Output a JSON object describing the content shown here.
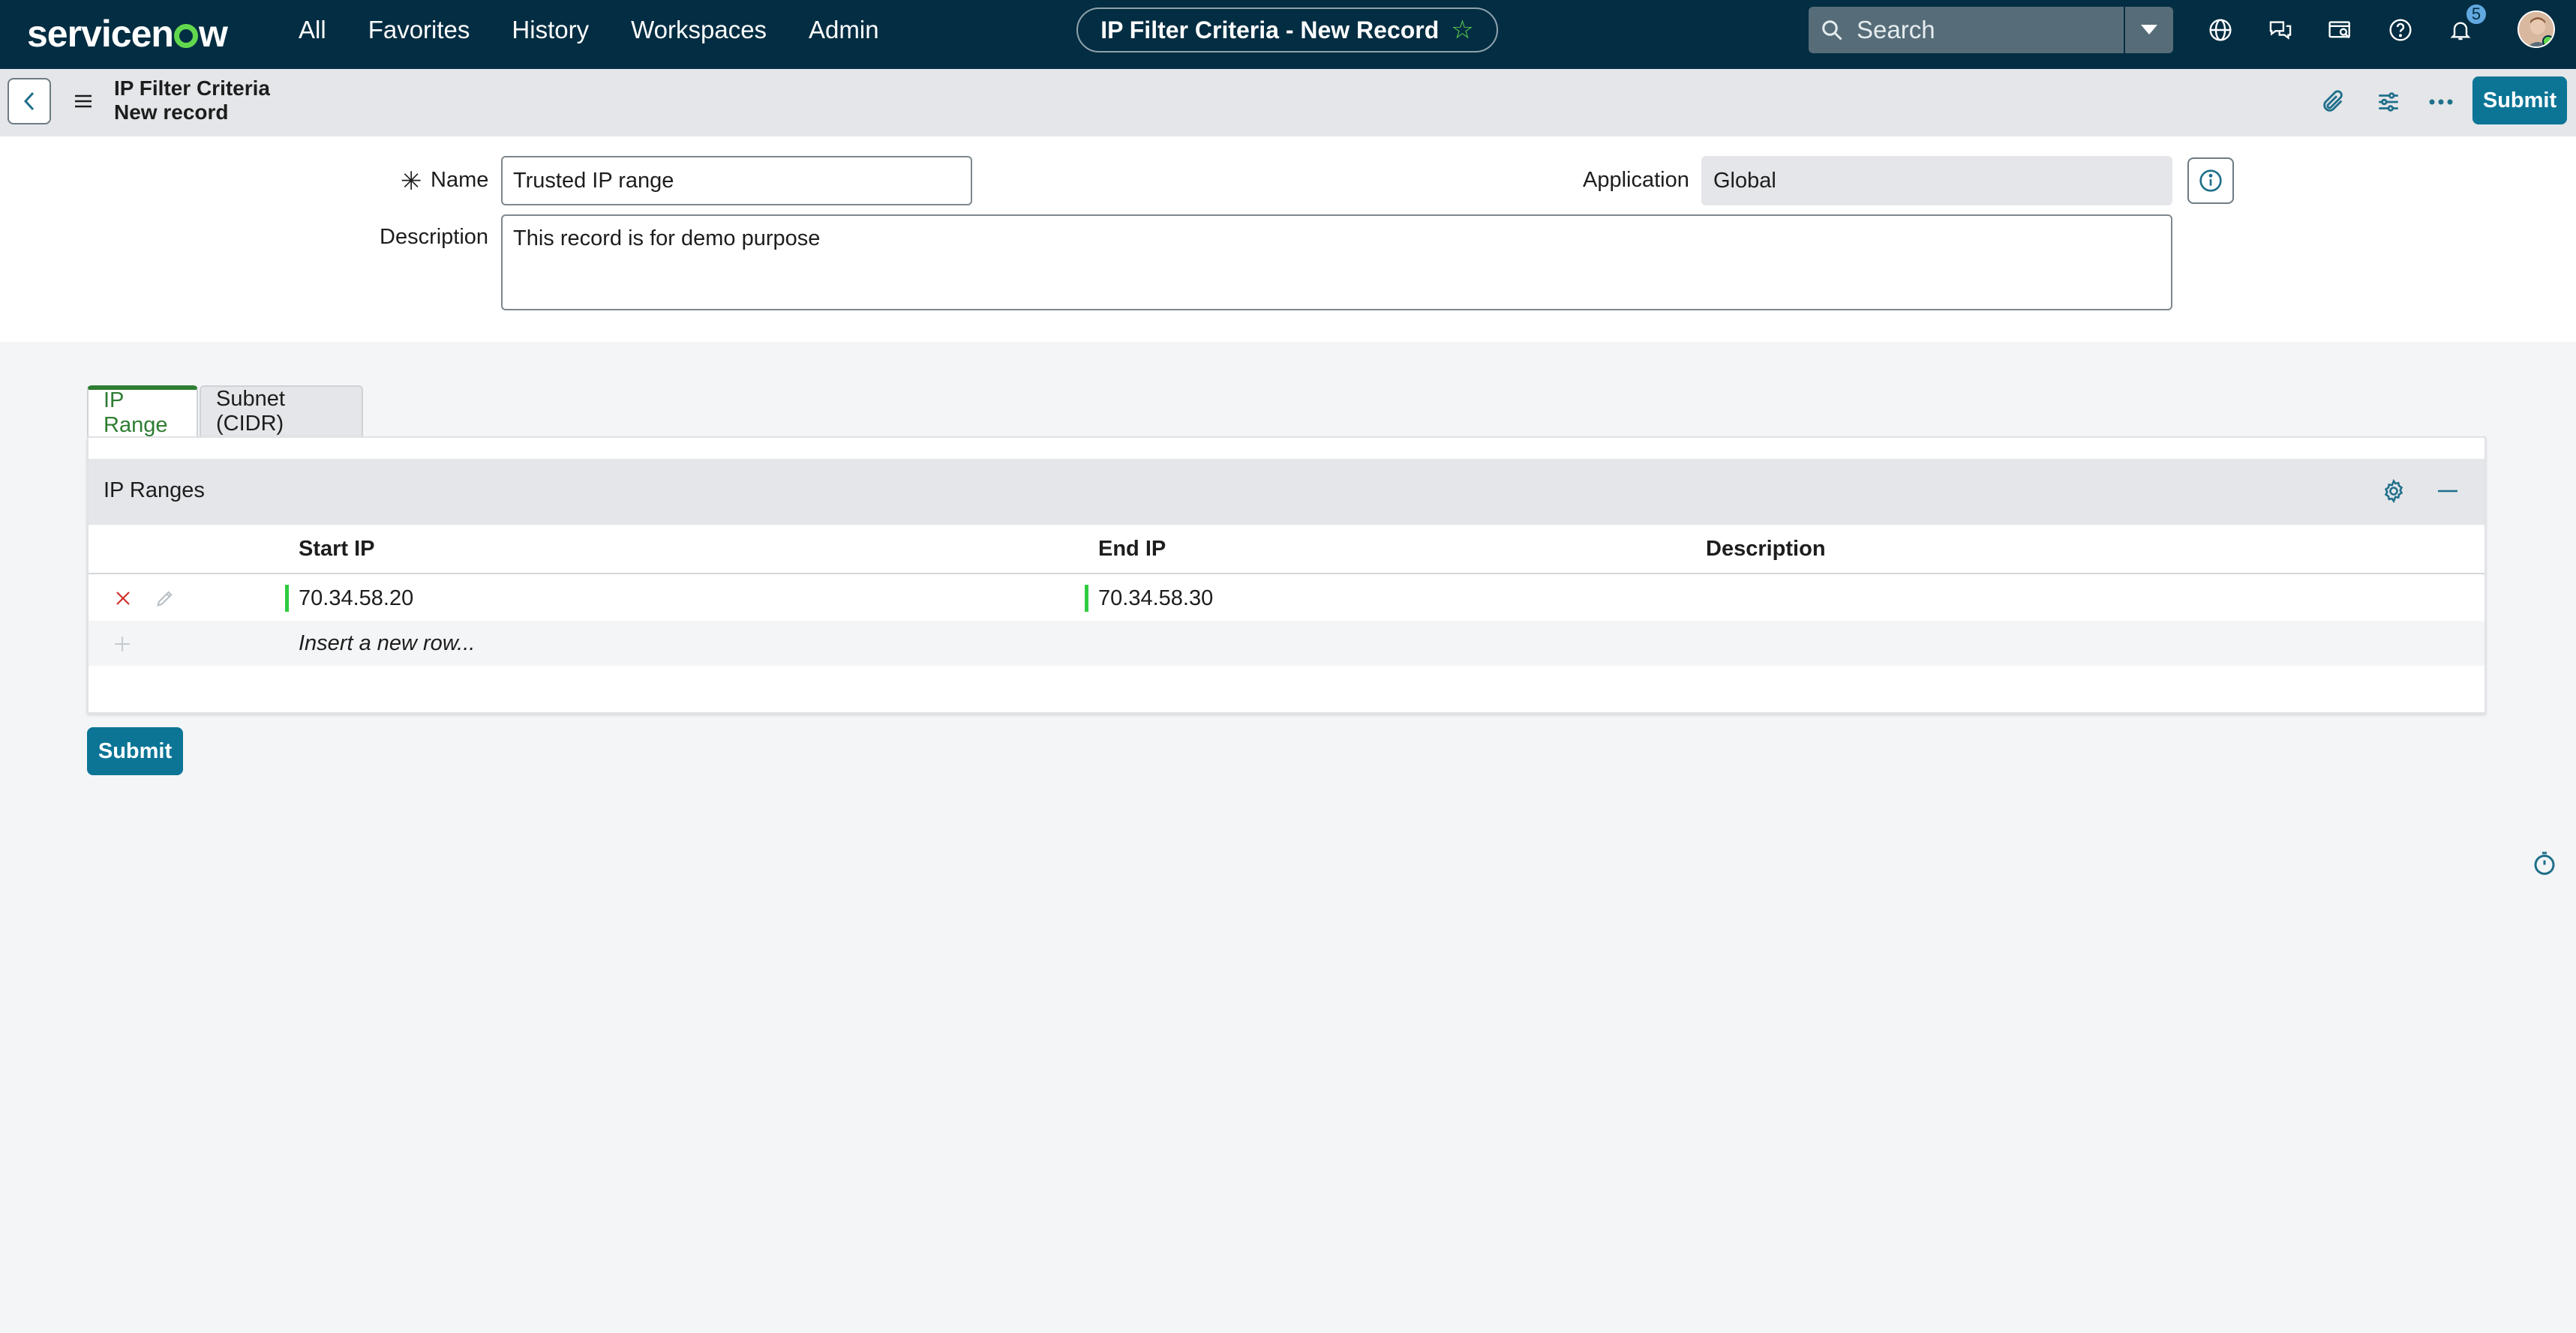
{
  "nav": {
    "logo_pre": "servicen",
    "logo_post": "w",
    "menu": [
      "All",
      "Favorites",
      "History",
      "Workspaces",
      "Admin"
    ],
    "title_pill": "IP Filter Criteria - New Record",
    "search_placeholder": "Search",
    "notification_count": "5",
    "icons": [
      "globe-icon",
      "chat-icon",
      "card-search-icon",
      "help-icon",
      "bell-icon"
    ]
  },
  "record": {
    "title_line1": "IP Filter Criteria",
    "title_line2": "New record",
    "submit_label": "Submit"
  },
  "form": {
    "name_label": "Name",
    "name_value": "Trusted IP range",
    "application_label": "Application",
    "application_value": "Global",
    "description_label": "Description",
    "description_value": "This record is for demo purpose"
  },
  "tabs": [
    {
      "label": "IP Range",
      "active": true
    },
    {
      "label": "Subnet (CIDR)",
      "active": false
    }
  ],
  "ip_ranges": {
    "title": "IP Ranges",
    "columns": [
      "Start IP",
      "End IP",
      "Description"
    ],
    "rows": [
      {
        "start_ip": "70.34.58.20",
        "end_ip": "70.34.58.30",
        "description": ""
      }
    ],
    "insert_label": "Insert a new row..."
  },
  "footer": {
    "submit_label": "Submit"
  },
  "colors": {
    "nav_bg": "#032d42",
    "accent_green": "#62d84e",
    "button_blue": "#0c7596",
    "tab_active": "#2e7d32"
  }
}
